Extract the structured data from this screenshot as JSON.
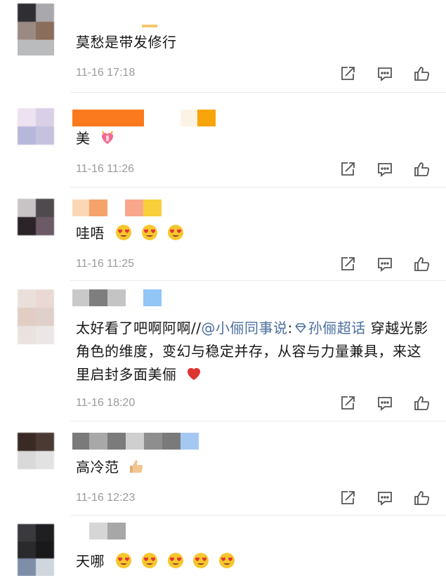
{
  "comments": [
    {
      "text": "莫愁是带发修行",
      "time": "11-16 17:18"
    },
    {
      "text": "美",
      "time": "11-16 11:26"
    },
    {
      "text": "哇唔",
      "time": "11-16 11:25"
    },
    {
      "text_before": "太好看了吧啊阿啊//",
      "mention": "@小俪同事说",
      "colon": ":",
      "topic": "孙俪超话",
      "text_after": " 穿越光影角色的维度，变幻与稳定并存，从容与力量兼具，来这里启封多面美俪",
      "time": "11-16 18:20"
    },
    {
      "text": "高冷范",
      "time": "11-16 12:23"
    },
    {
      "text": "天哪",
      "time": ""
    }
  ],
  "icons": {
    "share": "share-icon",
    "comment": "comment-icon",
    "like": "thumbs-up-icon",
    "heart_eyes": "heart-eyes-emoji",
    "heart": "red-heart-emoji",
    "thumbs": "thumbs-up-emoji",
    "gift_heart": "heart-gift-emoji",
    "diamond": "diamond-icon"
  },
  "colors": {
    "link": "#4a6e9e",
    "time": "#9a9a9a",
    "icon": "#555555",
    "heart": "#e0322f"
  }
}
